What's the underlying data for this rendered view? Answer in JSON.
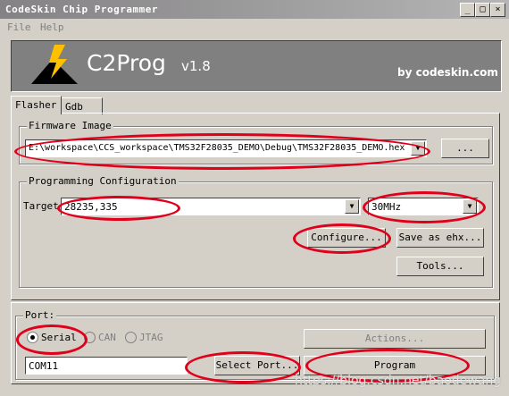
{
  "window": {
    "title": "CodeSkin Chip Programmer"
  },
  "menu": {
    "items": [
      "File",
      "Help"
    ]
  },
  "banner": {
    "app_name": "C2Prog",
    "version": "v1.8",
    "by": "by codeskin.com"
  },
  "tabs": [
    "Flasher",
    "Gdb"
  ],
  "firmware": {
    "legend": "Firmware Image",
    "path": "E:\\workspace\\CCS_workspace\\TMS32F28035_DEMO\\Debug\\TMS32F28035_DEMO.hex",
    "browse_label": "..."
  },
  "config": {
    "legend": "Programming Configuration",
    "target_label": "Target",
    "target_value": "28235,335",
    "clock_value": "30MHz",
    "configure_label": "Configure...",
    "save_ehx_label": "Save as ehx...",
    "tools_label": "Tools..."
  },
  "port": {
    "legend": "Port:",
    "options": [
      "Serial",
      "CAN",
      "JTAG"
    ],
    "selected": "Serial",
    "value": "COM11",
    "select_port_label": "Select Port...",
    "actions_label": "Actions...",
    "program_label": "Program"
  },
  "watermark": "https://blog.csdn.net/baodewang",
  "colors": {
    "annotation": "#e0001b",
    "face": "#d4d0c8",
    "banner": "#808080"
  }
}
